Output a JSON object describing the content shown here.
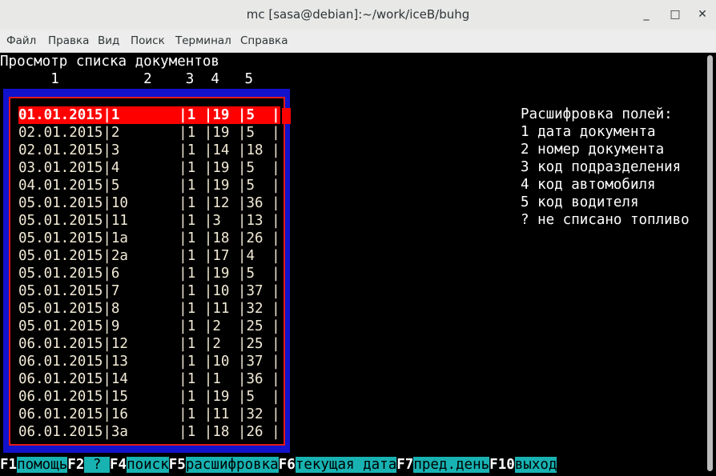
{
  "window": {
    "title": "mc [sasa@debian]:~/work/iceB/buhg",
    "minimize": "_",
    "maximize": "□",
    "close": "✕"
  },
  "menu": [
    "Файл",
    "Правка",
    "Вид",
    "Поиск",
    "Терминал",
    "Справка"
  ],
  "screen": {
    "heading": "Просмотр списка документов",
    "column_numbers": "      1          2    3  4   5"
  },
  "documents": {
    "selected_index": 0,
    "rows": [
      "01.01.2015|1       |1 |19 |5  |",
      "02.01.2015|2       |1 |19 |5  |",
      "02.01.2015|3       |1 |14 |18 |",
      "03.01.2015|4       |1 |19 |5  |",
      "04.01.2015|5       |1 |19 |5  |",
      "05.01.2015|10      |1 |12 |36 |",
      "05.01.2015|11      |1 |3  |13 |",
      "05.01.2015|1а      |1 |18 |26 |",
      "05.01.2015|2а      |1 |17 |4  |",
      "05.01.2015|6       |1 |19 |5  |",
      "05.01.2015|7       |1 |10 |37 |",
      "05.01.2015|8       |1 |11 |32 |",
      "05.01.2015|9       |1 |2  |25 |",
      "06.01.2015|12      |1 |2  |25 |",
      "06.01.2015|13      |1 |10 |37 |",
      "06.01.2015|14      |1 |1  |36 |",
      "06.01.2015|15      |1 |19 |5  |",
      "06.01.2015|16      |1 |11 |32 |",
      "06.01.2015|3а      |1 |18 |26 |"
    ]
  },
  "legend": [
    "Расшифровка полей:",
    "1 дата документа",
    "2 номер документа",
    "3 код подразделения",
    "4 код автомобиля",
    "5 код водителя",
    "? не списано топливо"
  ],
  "function_keys": [
    {
      "key": "F1",
      "label": "помощь"
    },
    {
      "key": "F2",
      "label": " ? "
    },
    {
      "key": "F4",
      "label": "поиск"
    },
    {
      "key": "F5",
      "label": "расшифровка"
    },
    {
      "key": "F6",
      "label": "текущая дата"
    },
    {
      "key": "F7",
      "label": "пред.день"
    },
    {
      "key": "F10",
      "label": "выход"
    }
  ],
  "colors": {
    "terminal_bg": "#000000",
    "list_border": "#1212cc",
    "frame": "#e01a1a",
    "selection": "#ff0000",
    "fkey_label_bg": "#18b2b2"
  }
}
